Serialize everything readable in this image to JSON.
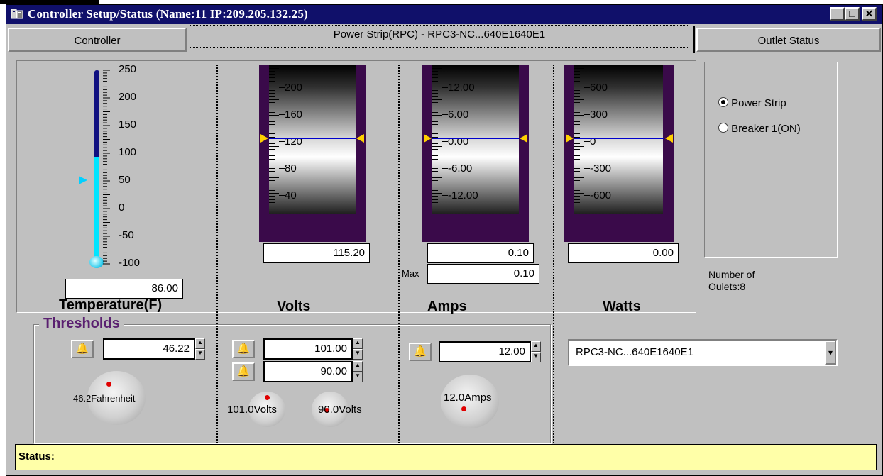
{
  "window": {
    "title": "Controller Setup/Status (Name:11 IP:209.205.132.25)",
    "minimize_glyph": "_",
    "maximize_glyph": "□",
    "close_glyph": "✕"
  },
  "tabs": [
    {
      "label": "Controller"
    },
    {
      "label": "Power Strip(RPC) - RPC3-NC...640E1640E1"
    },
    {
      "label": "Outlet Status"
    }
  ],
  "temperature": {
    "ticks": [
      "250",
      "200",
      "150",
      "100",
      "50",
      "0",
      "-50",
      "-100"
    ],
    "value": "86.00",
    "label": "Temperature(F)",
    "level_fraction": 0.54,
    "threshold_marker": 50
  },
  "volts": {
    "ticks": [
      "200",
      "160",
      "120",
      "80",
      "40"
    ],
    "value": "115.20",
    "label": "Volts"
  },
  "amps": {
    "ticks": [
      "12.00",
      "6.00",
      "0.00",
      "-6.00",
      "-12.00"
    ],
    "value": "0.10",
    "max_label": "Max",
    "max_value": "0.10",
    "label": "Amps"
  },
  "watts": {
    "ticks": [
      "600",
      "300",
      "0",
      "-300",
      "-600"
    ],
    "value": "0.00",
    "label": "Watts"
  },
  "selection": {
    "options": [
      {
        "label": "Power Strip",
        "checked": true
      },
      {
        "label": "Breaker 1(ON)",
        "checked": false
      }
    ],
    "outlets_line1": "Number of",
    "outlets_line2": "Oulets:8"
  },
  "thresholds": {
    "title": "Thresholds",
    "temp_value": "46.22",
    "temp_knob_label": "46.2Fahrenheit",
    "volts_high": "101.00",
    "volts_low": "90.00",
    "volts_high_knob": "101.0Volts",
    "volts_low_knob": "90.0Volts",
    "amps_value": "12.00",
    "amps_knob": "12.0Amps",
    "bell_glyph": "🔔"
  },
  "device_select": {
    "value": "RPC3-NC...640E1640E1",
    "arrow": "▾"
  },
  "status": {
    "label": "Status:"
  },
  "colors": {
    "titlebar": "#10106a",
    "gauge_frame": "#3a0a4a",
    "thermo_fill": "#00e5ff",
    "thermo_empty": "#101080",
    "level_line": "#0000cc",
    "marker": "#ffd000",
    "status_bg": "#ffffa8"
  }
}
